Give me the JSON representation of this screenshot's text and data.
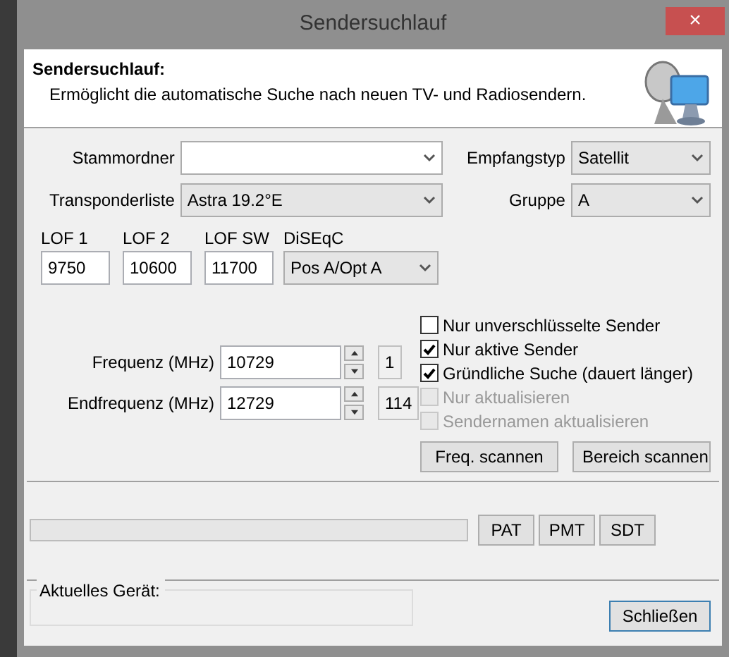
{
  "window": {
    "title": "Sendersuchlauf",
    "close": "×"
  },
  "header": {
    "title": "Sendersuchlauf:",
    "description": "Ermöglicht die automatische Suche nach neuen TV- und Radiosendern."
  },
  "folder": {
    "label": "Stammordner"
  },
  "receive_type": {
    "label": "Empfangstyp",
    "value": "Satellit"
  },
  "transponder_list": {
    "label": "Transponderliste",
    "value": "Astra 19.2°E"
  },
  "group": {
    "label": "Gruppe",
    "value": "A"
  },
  "lof": [
    {
      "label": "LOF 1",
      "value": "9750"
    },
    {
      "label": "LOF 2",
      "value": "10600"
    },
    {
      "label": "LOF SW",
      "value": "11700"
    }
  ],
  "diseqc": {
    "label": "DiSEqC",
    "value": "Pos A/Opt A"
  },
  "frequencies": [
    {
      "label": "Frequenz (MHz)",
      "value": "10729",
      "index": "1"
    },
    {
      "label": "Endfrequenz (MHz)",
      "value": "12729",
      "index": "114"
    }
  ],
  "options": [
    {
      "label": "Nur unverschlüsselte Sender",
      "checked": false,
      "disabled": false
    },
    {
      "label": "Nur aktive Sender",
      "checked": true,
      "disabled": false
    },
    {
      "label": "Gründliche Suche (dauert länger)",
      "checked": true,
      "disabled": false
    },
    {
      "label": "Nur aktualisieren",
      "checked": false,
      "disabled": true
    },
    {
      "label": "Sendernamen aktualisieren",
      "checked": false,
      "disabled": true
    }
  ],
  "scan_buttons": [
    "Freq. scannen",
    "Bereich scannen"
  ],
  "table_buttons": [
    "PAT",
    "PMT",
    "SDT"
  ],
  "device": {
    "label": "Aktuelles Gerät:"
  },
  "close_button": "Schließen"
}
